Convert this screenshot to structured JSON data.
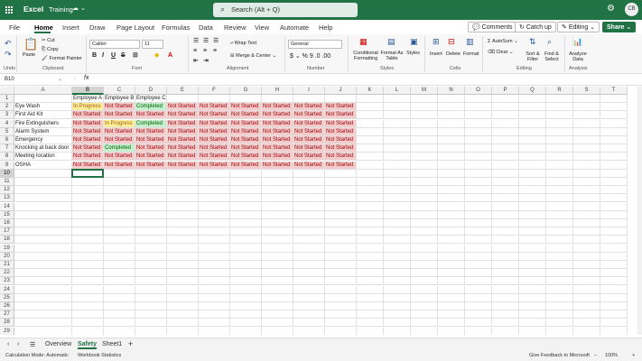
{
  "titlebar": {
    "app": "Excel",
    "workbook": "Training",
    "search_placeholder": "Search (Alt + Q)",
    "avatar": "CB"
  },
  "tabs": [
    "File",
    "Home",
    "Insert",
    "Draw",
    "Page Layout",
    "Formulas",
    "Data",
    "Review",
    "View",
    "Automate",
    "Help"
  ],
  "actions": {
    "comments": "Comments",
    "catchup": "Catch up",
    "editing": "Editing",
    "share": "Share"
  },
  "ribbon": {
    "paste": "Paste",
    "cut": "Cut",
    "copy": "Copy",
    "format_painter": "Format Painter",
    "font": "Calibri",
    "size": "11",
    "wrap": "Wrap Text",
    "merge": "Merge & Center",
    "number_format": "General",
    "conditional": "Conditional Formatting",
    "format_table": "Format As Table",
    "styles": "Styles",
    "insert": "Insert",
    "delete": "Delete",
    "format": "Format",
    "autosum": "AutoSum",
    "clear": "Clear",
    "sort": "Sort & Filter",
    "find": "Find & Select",
    "analyze": "Analyze Data",
    "groups": [
      "Undo",
      "Clipboard",
      "Font",
      "Alignment",
      "Number",
      "Styles",
      "Cells",
      "Editing",
      "Analysis"
    ]
  },
  "formula": {
    "namebox": "B10",
    "fx": "fx"
  },
  "columns": [
    "A",
    "B",
    "C",
    "D",
    "E",
    "F",
    "G",
    "H",
    "I",
    "J",
    "K",
    "L",
    "M",
    "N",
    "O",
    "P",
    "Q",
    "R",
    "S",
    "T"
  ],
  "rows": [
    "1",
    "2",
    "3",
    "4",
    "5",
    "6",
    "7",
    "8",
    "9",
    "10",
    "11",
    "12",
    "13",
    "14",
    "15",
    "16",
    "17",
    "18",
    "19",
    "20",
    "21",
    "22",
    "23",
    "24",
    "25",
    "26",
    "27",
    "28",
    "29"
  ],
  "headers": [
    "",
    "Employee A",
    "Employee B",
    "Employee C"
  ],
  "data": [
    {
      "name": "Eye Wash",
      "status": [
        "In Progress",
        "Not Started",
        "Completed",
        "Not Started",
        "Not Started",
        "Not Started",
        "Not Started",
        "Not Started",
        "Not Started"
      ]
    },
    {
      "name": "First Aid Kit",
      "status": [
        "Not Started",
        "Not Started",
        "Not Started",
        "Not Started",
        "Not Started",
        "Not Started",
        "Not Started",
        "Not Started",
        "Not Started"
      ]
    },
    {
      "name": "Fire Extinguishers",
      "status": [
        "Not Started",
        "In Progress",
        "Completed",
        "Not Started",
        "Not Started",
        "Not Started",
        "Not Started",
        "Not Started",
        "Not Started"
      ]
    },
    {
      "name": "Alarm System",
      "status": [
        "Not Started",
        "Not Started",
        "Not Started",
        "Not Started",
        "Not Started",
        "Not Started",
        "Not Started",
        "Not Started",
        "Not Started"
      ]
    },
    {
      "name": "Emergency",
      "status": [
        "Not Started",
        "Not Started",
        "Not Started",
        "Not Started",
        "Not Started",
        "Not Started",
        "Not Started",
        "Not Started",
        "Not Started"
      ]
    },
    {
      "name": "Knocking at back door",
      "status": [
        "Not Started",
        "Completed",
        "Not Started",
        "Not Started",
        "Not Started",
        "Not Started",
        "Not Started",
        "Not Started",
        "Not Started"
      ]
    },
    {
      "name": "Meeting location",
      "status": [
        "Not Started",
        "Not Started",
        "Not Started",
        "Not Started",
        "Not Started",
        "Not Started",
        "Not Started",
        "Not Started",
        "Not Started"
      ]
    },
    {
      "name": "OSHA",
      "status": [
        "Not Started",
        "Not Started",
        "Not Started",
        "Not Started",
        "Not Started",
        "Not Started",
        "Not Started",
        "Not Started",
        "Not Started"
      ]
    }
  ],
  "sheets": [
    "Overview",
    "Safety",
    "Sheet1"
  ],
  "active_sheet": "Safety",
  "status": {
    "calc": "Calculation Mode: Automatic",
    "stats": "Workbook Statistics",
    "feedback": "Give Feedback to Microsoft",
    "zoom": "100%"
  },
  "colors": {
    "brand": "#217346",
    "not_started": "#f4cccc",
    "in_progress": "#ffeb9c",
    "completed": "#c6efce"
  }
}
